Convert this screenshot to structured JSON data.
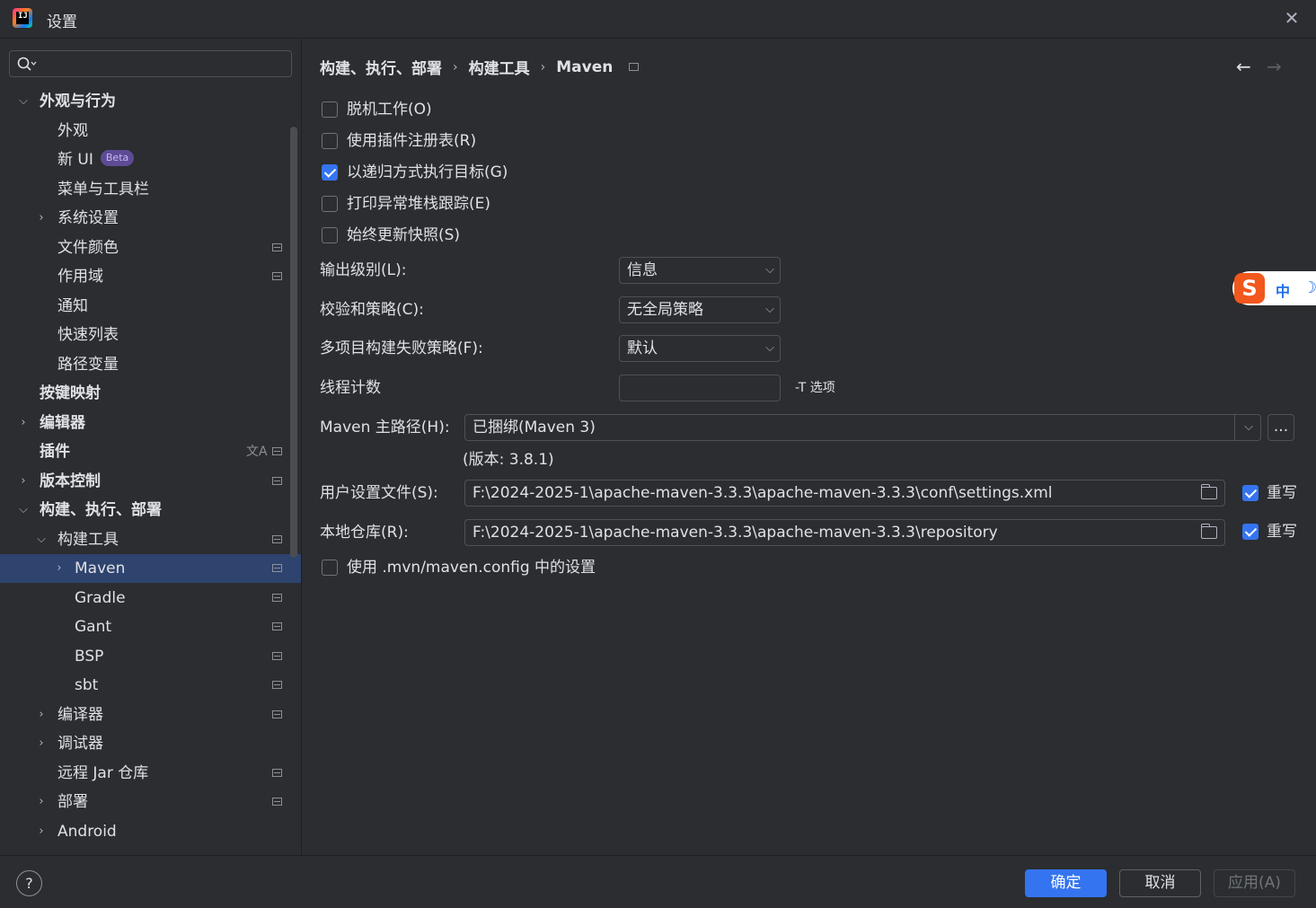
{
  "window": {
    "title": "设置",
    "close_icon": "close-icon"
  },
  "search": {
    "placeholder": "",
    "value": ""
  },
  "sidebar": {
    "items": [
      {
        "label": "外观与行为"
      },
      {
        "label": "外观"
      },
      {
        "label": "新 UI",
        "badge": "Beta"
      },
      {
        "label": "菜单与工具栏"
      },
      {
        "label": "系统设置"
      },
      {
        "label": "文件颜色"
      },
      {
        "label": "作用域"
      },
      {
        "label": "通知"
      },
      {
        "label": "快速列表"
      },
      {
        "label": "路径变量"
      },
      {
        "label": "按键映射"
      },
      {
        "label": "编辑器"
      },
      {
        "label": "插件"
      },
      {
        "label": "版本控制"
      },
      {
        "label": "构建、执行、部署"
      },
      {
        "label": "构建工具"
      },
      {
        "label": "Maven"
      },
      {
        "label": "Gradle"
      },
      {
        "label": "Gant"
      },
      {
        "label": "BSP"
      },
      {
        "label": "sbt"
      },
      {
        "label": "编译器"
      },
      {
        "label": "调试器"
      },
      {
        "label": "远程 Jar 仓库"
      },
      {
        "label": "部署"
      },
      {
        "label": "Android"
      }
    ]
  },
  "breadcrumb": {
    "part1": "构建、执行、部署",
    "part2": "构建工具",
    "part3": "Maven"
  },
  "options": {
    "offline": {
      "label": "脱机工作(O)",
      "checked": false
    },
    "plugin_registry": {
      "label": "使用插件注册表(R)",
      "checked": false
    },
    "recursive": {
      "label": "以递归方式执行目标(G)",
      "checked": true
    },
    "stack_trace": {
      "label": "打印异常堆栈跟踪(E)",
      "checked": false
    },
    "update_snapshots": {
      "label": "始终更新快照(S)",
      "checked": false
    }
  },
  "fields": {
    "output_level": {
      "label": "输出级别(L):",
      "value": "信息"
    },
    "checksum_policy": {
      "label": "校验和策略(C):",
      "value": "无全局策略"
    },
    "failure_policy": {
      "label": "多项目构建失败策略(F):",
      "value": "默认"
    },
    "thread_count": {
      "label": "线程计数",
      "value": "",
      "hint": "-T 选项"
    },
    "maven_home": {
      "label": "Maven 主路径(H):",
      "value": "已捆绑(Maven 3)",
      "browse": "...",
      "version": "(版本: 3.8.1)"
    },
    "user_settings": {
      "label": "用户设置文件(S):",
      "value": "F:\\2024-2025-1\\apache-maven-3.3.3\\apache-maven-3.3.3\\conf\\settings.xml",
      "override_label": "重写",
      "override": true
    },
    "local_repo": {
      "label": "本地仓库(R):",
      "value": "F:\\2024-2025-1\\apache-maven-3.3.3\\apache-maven-3.3.3\\repository",
      "override_label": "重写",
      "override": true
    },
    "mvn_config": {
      "label": "使用 .mvn/maven.config 中的设置",
      "checked": false
    }
  },
  "ime": {
    "logo": "S",
    "mode": "中",
    "moon": "☽"
  },
  "footer": {
    "help": "?",
    "ok": "确定",
    "cancel": "取消",
    "apply": "应用(A)"
  },
  "colors": {
    "accent": "#3574f0",
    "background": "#2b2d30",
    "selection": "#2e436e",
    "text": "#dfe1e5"
  }
}
